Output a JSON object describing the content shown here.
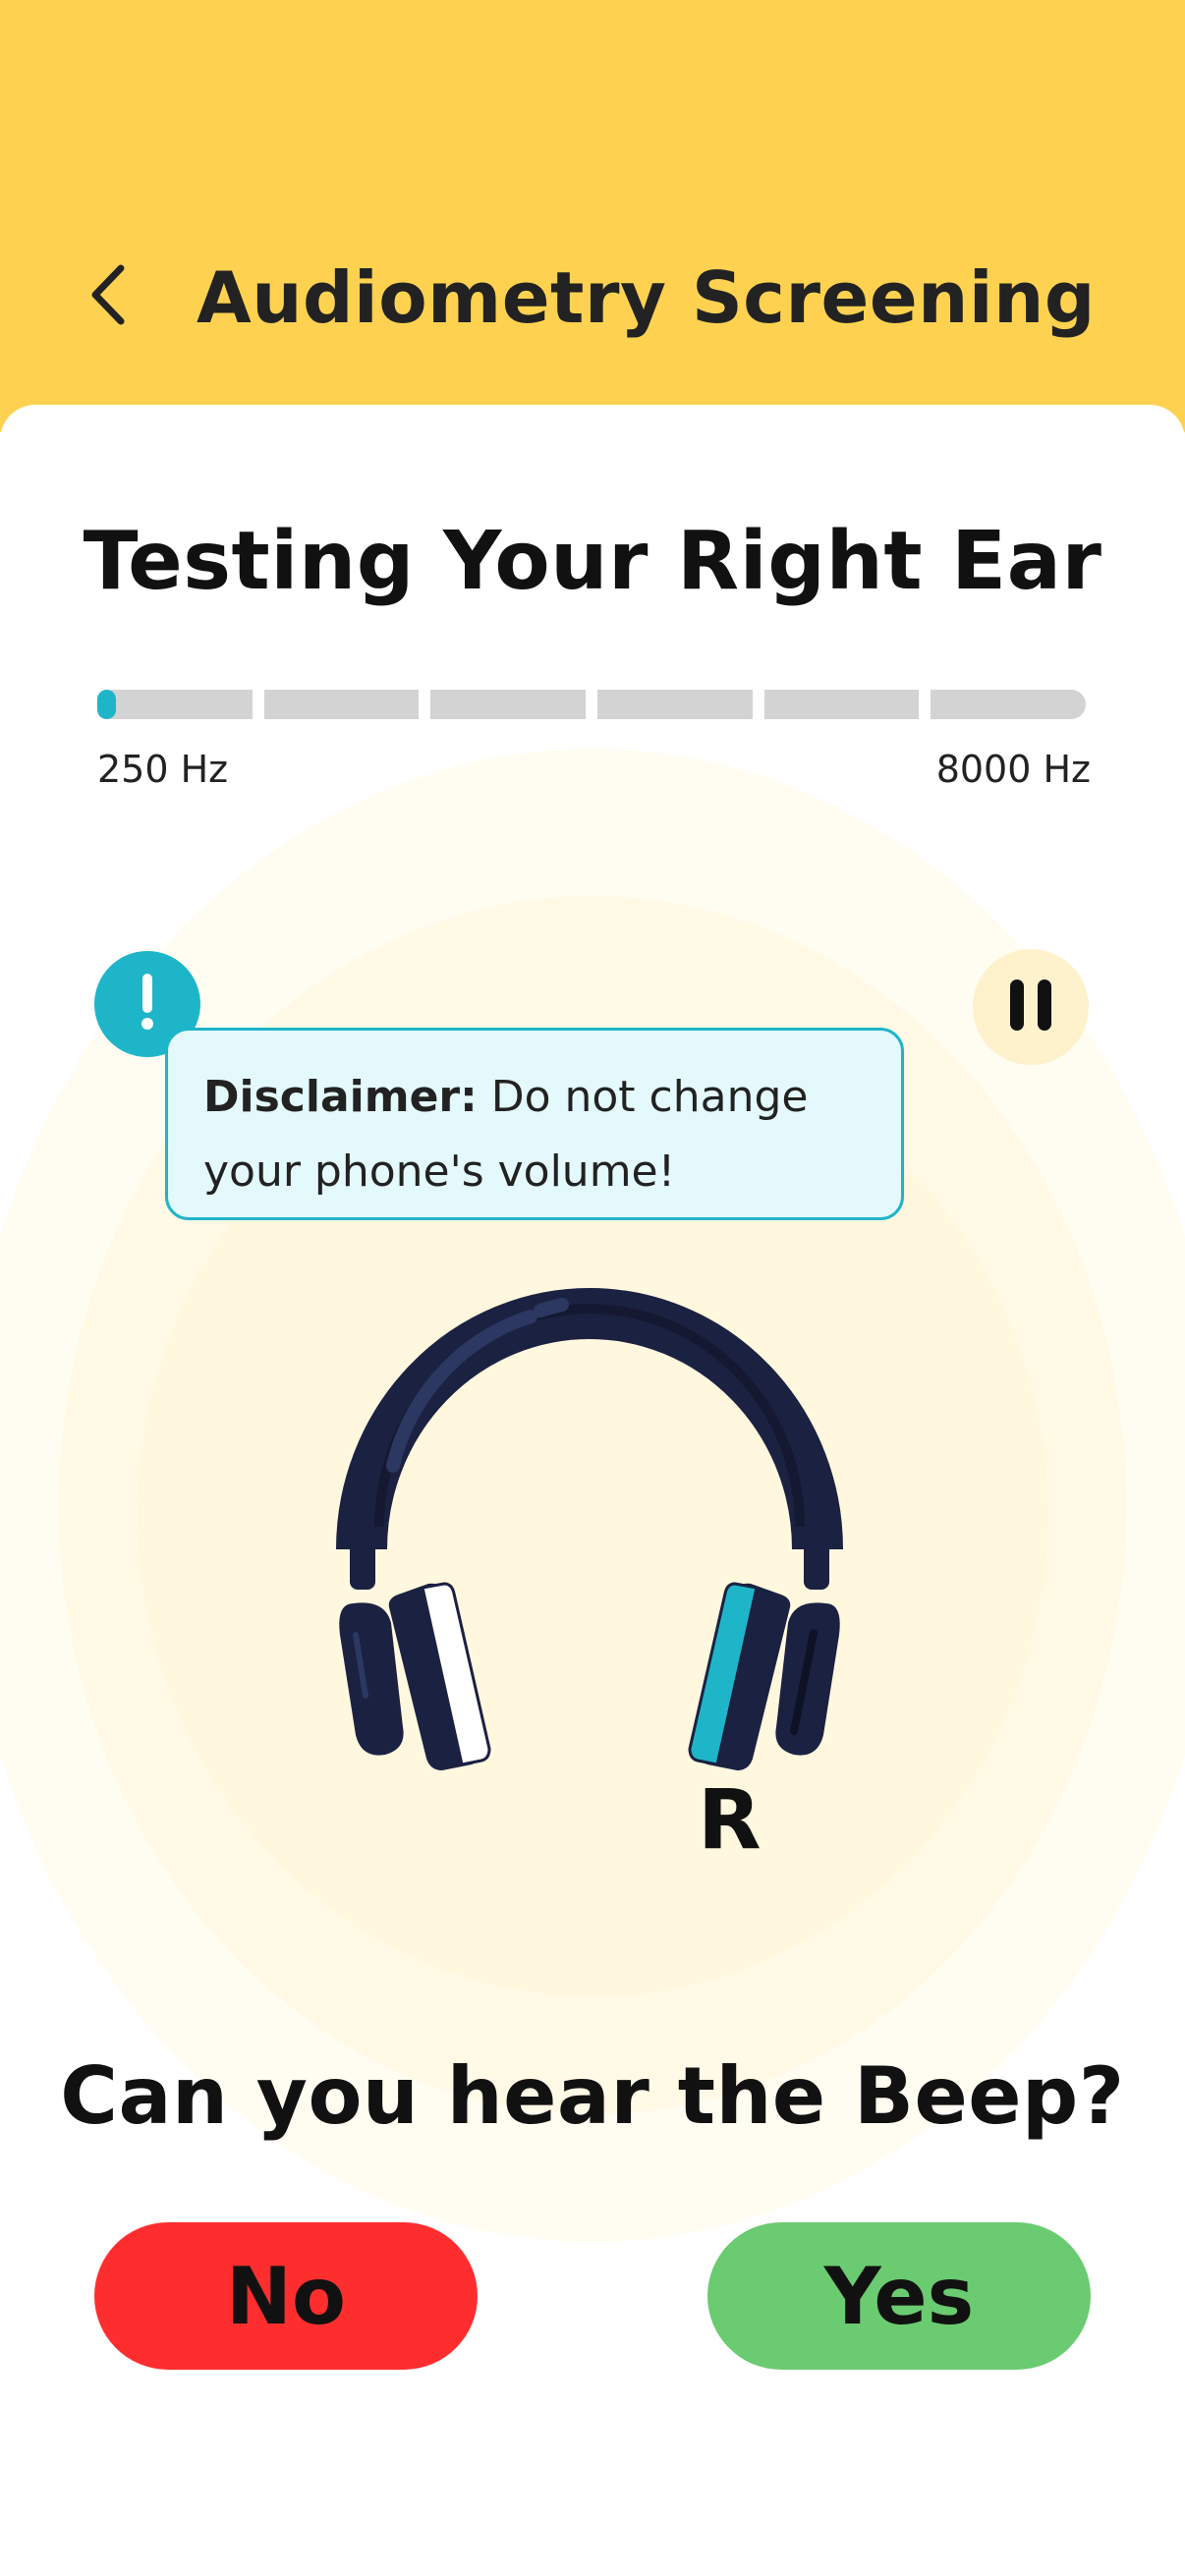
{
  "header": {
    "title": "Audiometry Screening",
    "back_icon": "chevron-left-icon"
  },
  "test": {
    "title": "Testing Your Right Ear",
    "progress": {
      "segments": 6,
      "current_fraction": 0.02,
      "accent_color": "#1fb5c9",
      "track_color": "#d3d3d3",
      "start_label": "250 Hz",
      "end_label": "8000 Hz"
    },
    "info_icon": "exclamation-icon",
    "pause_icon": "pause-icon",
    "disclaimer": {
      "label": "Disclaimer:",
      "text": " Do not change your phone's volume!"
    },
    "headphones_icon": "headphones-icon",
    "ear_letter": "R",
    "question": "Can you hear the Beep?",
    "buttons": {
      "no": "No",
      "yes": "Yes"
    }
  },
  "colors": {
    "header_bg": "#fed250",
    "no_button": "#ff2e2e",
    "yes_button": "#6acb70",
    "accent": "#1fb5c9"
  }
}
